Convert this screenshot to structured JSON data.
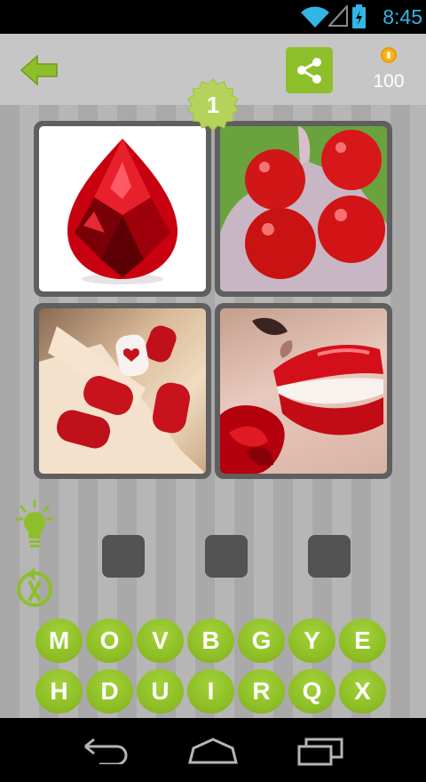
{
  "status_bar": {
    "time": "8:45",
    "icons": [
      "wifi-icon",
      "signal-icon",
      "battery-icon"
    ],
    "clock_color": "#33b5e5"
  },
  "header": {
    "back_icon": "back-arrow-icon",
    "share_icon": "share-icon",
    "coin_icon": "coin-icon",
    "coins": "100",
    "level": "1"
  },
  "puzzle": {
    "pictures": [
      {
        "name": "ruby-gem-picture"
      },
      {
        "name": "tomatoes-picture"
      },
      {
        "name": "red-nails-picture"
      },
      {
        "name": "red-lips-picture"
      }
    ],
    "answer_slots": 3
  },
  "tools": {
    "hint_icon": "lightbulb-icon",
    "remove_icon": "remove-letters-icon"
  },
  "letters": {
    "row1": [
      "M",
      "O",
      "V",
      "B",
      "G",
      "Y",
      "E"
    ],
    "row2": [
      "H",
      "D",
      "U",
      "I",
      "R",
      "Q",
      "X"
    ]
  },
  "nav_bar": {
    "icons": [
      "back-icon",
      "home-icon",
      "recents-icon"
    ]
  },
  "colors": {
    "accent_green": "#8dbf2b",
    "slot": "#535353",
    "tile_frame": "#5f5f5f"
  }
}
